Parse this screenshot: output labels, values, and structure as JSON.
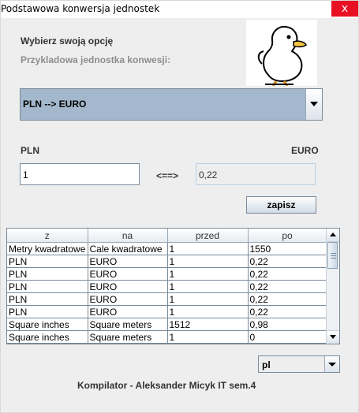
{
  "window": {
    "title": "Podstawowa konwersja jednostek",
    "close_glyph": "x"
  },
  "labels": {
    "choose_option": "Wybierz swoją opcję",
    "example_unit": "Przykladowa jednostka konwesji:",
    "from_unit": "PLN",
    "to_unit": "EURO",
    "arrow": "<==>",
    "footer": "Kompilator - Aleksander Micyk IT sem.4"
  },
  "conversion_combo": {
    "selected": "PLN --> EURO"
  },
  "inputs": {
    "from_value": "1",
    "to_value": "0,22"
  },
  "buttons": {
    "save": "zapisz"
  },
  "table": {
    "headers": [
      "z",
      "na",
      "przed",
      "po"
    ],
    "rows": [
      [
        "Metry kwadratowe",
        "Cale kwadratowe",
        "1",
        "1550"
      ],
      [
        "PLN",
        "EURO",
        "1",
        "0,22"
      ],
      [
        "PLN",
        "EURO",
        "1",
        "0,22"
      ],
      [
        "PLN",
        "EURO",
        "1",
        "0,22"
      ],
      [
        "PLN",
        "EURO",
        "1",
        "0,22"
      ],
      [
        "PLN",
        "EURO",
        "1",
        "0,22"
      ],
      [
        "Square inches",
        "Square meters",
        "1512",
        "0,98"
      ],
      [
        "Square inches",
        "Square meters",
        "1",
        "0"
      ]
    ]
  },
  "language_combo": {
    "selected": "pl"
  },
  "icons": {
    "duck": "duck-illustration",
    "close": "close-icon",
    "dropdown": "chevron-down-icon"
  },
  "colors": {
    "combo_selected_bg": "#a3b8cc",
    "close_bg": "#e81123",
    "window_bg": "#eeeeee"
  }
}
